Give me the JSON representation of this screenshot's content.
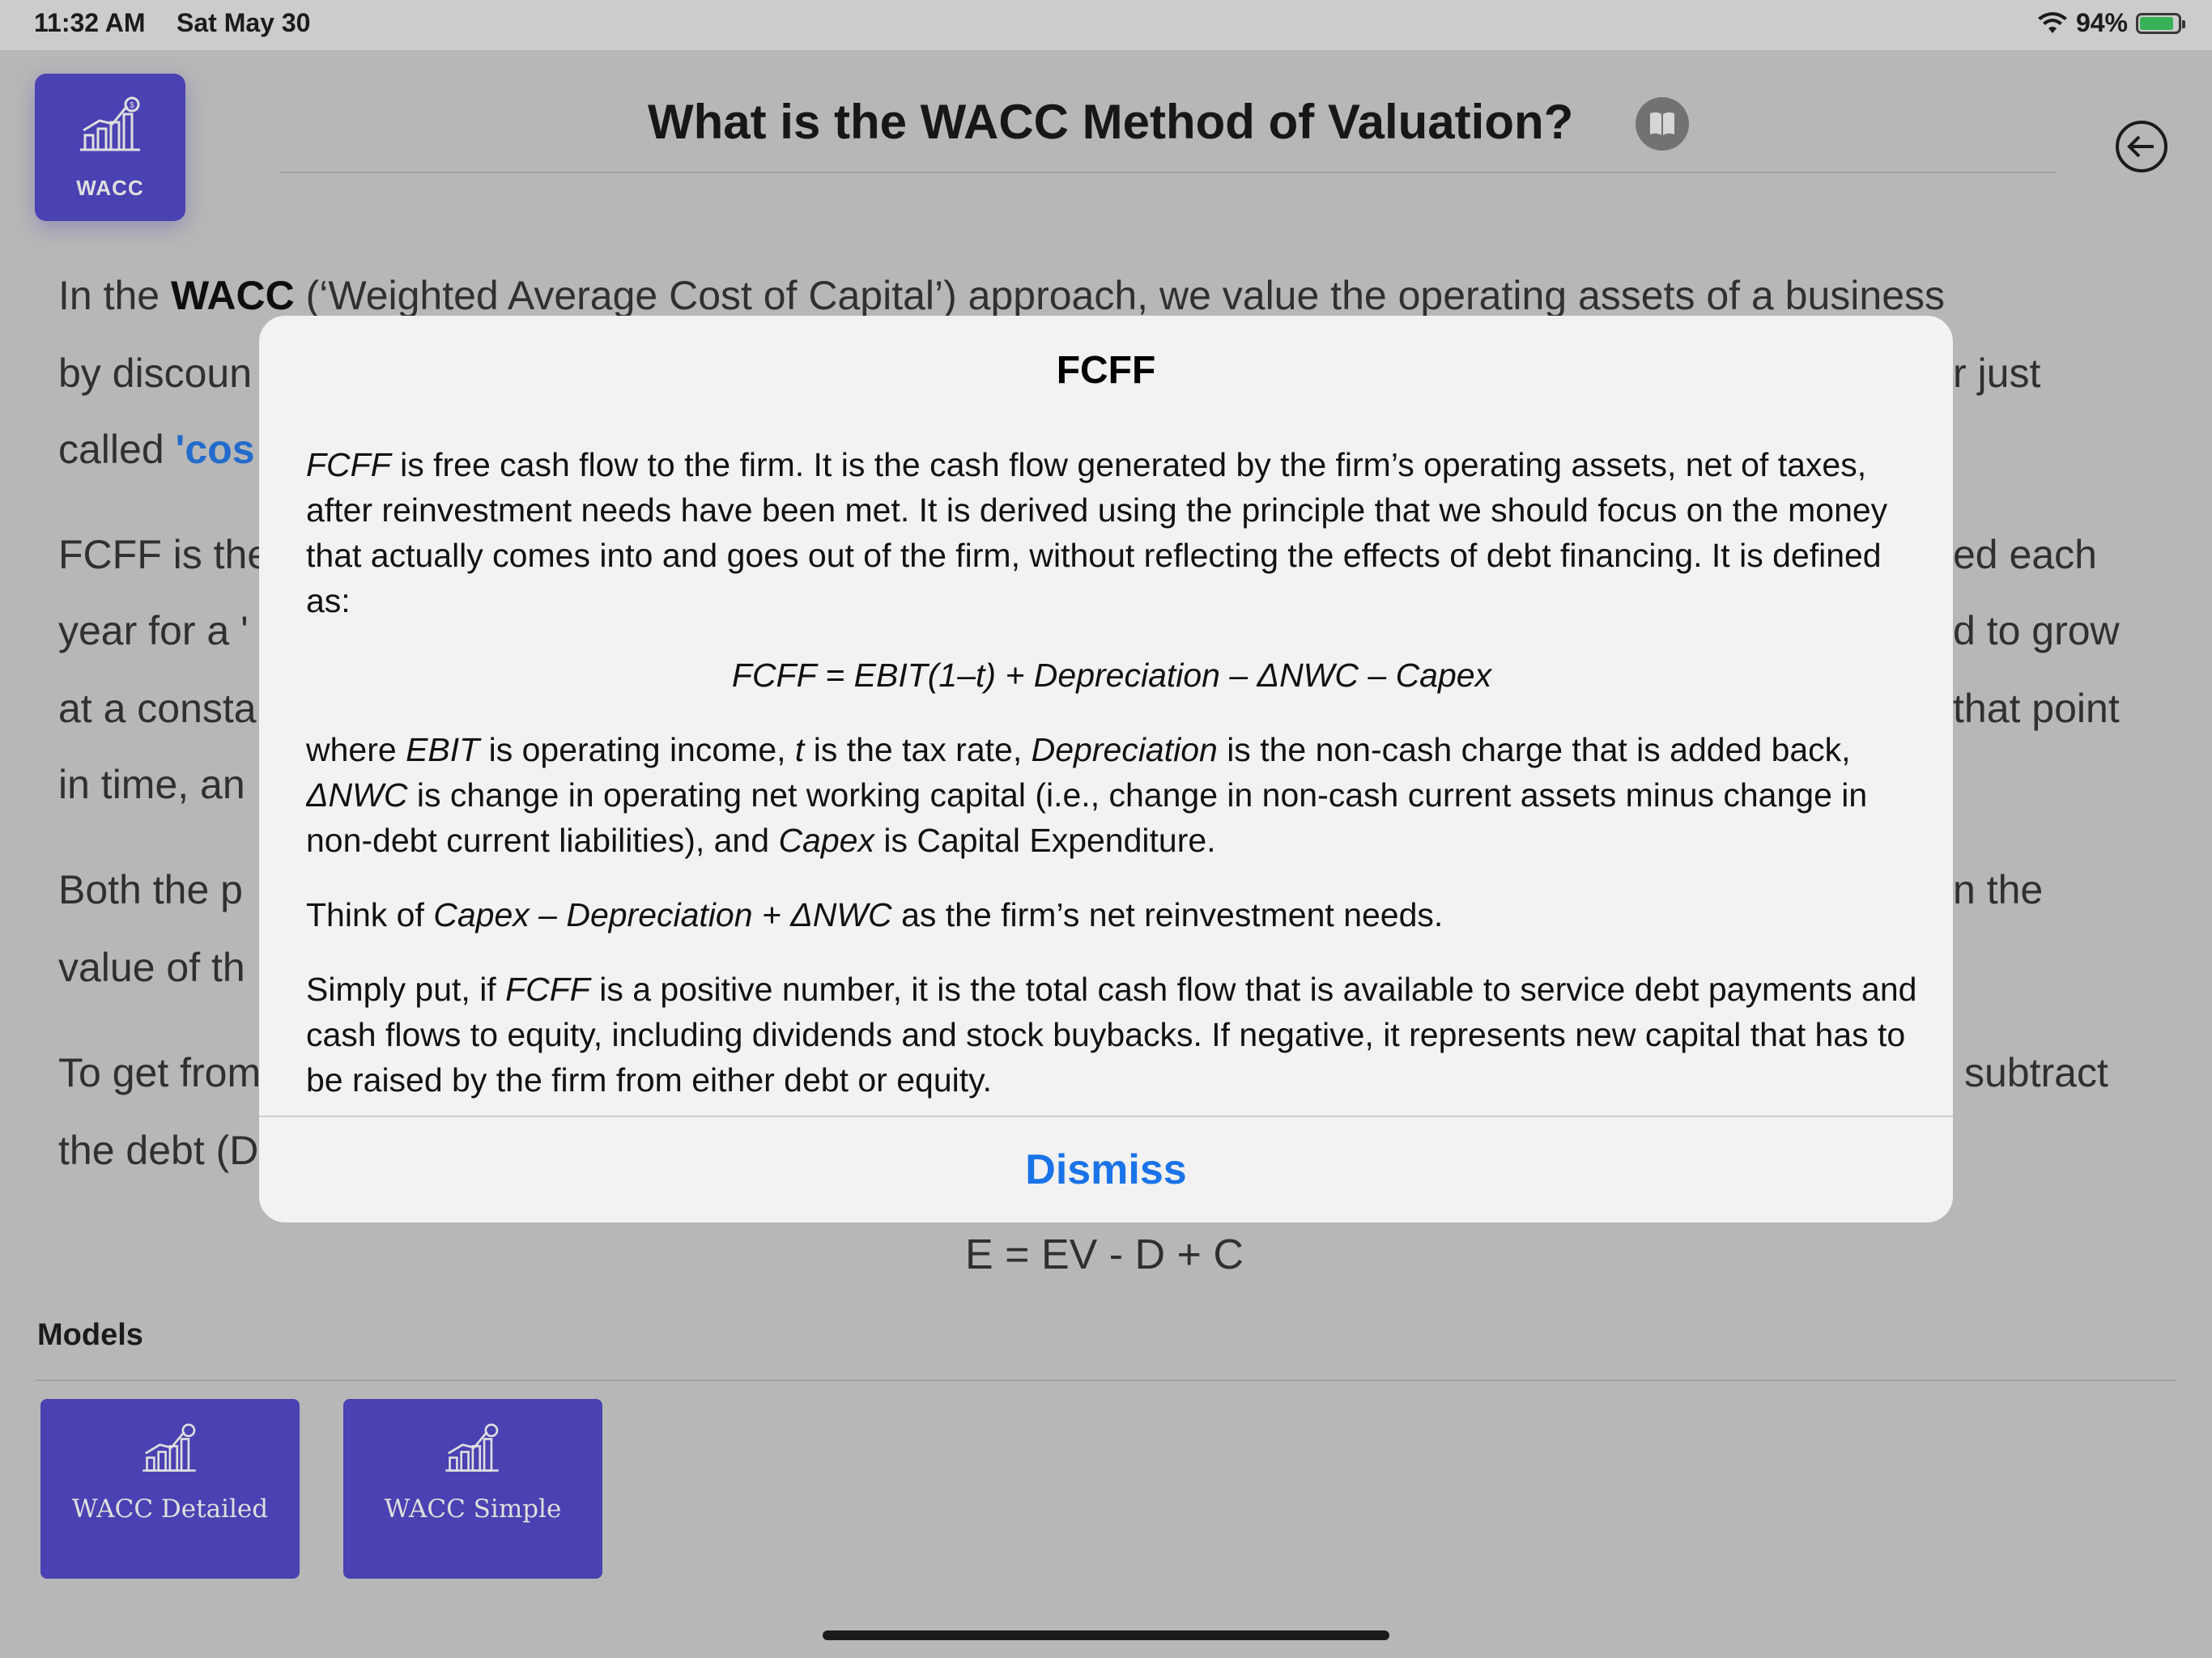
{
  "status_bar": {
    "time": "11:32 AM",
    "date": "Sat May 30",
    "battery_text": "94%",
    "battery_level": 0.94,
    "battery_color": "#35c759"
  },
  "app": {
    "badge_label": "WACC",
    "badge_icon": "bar-chart-dollar-icon",
    "accent_color": "#4a3fc9",
    "title": "What is the WACC Method of Valuation?",
    "title_icon": "book-icon",
    "back_icon": "back-arrow-icon"
  },
  "article": {
    "lines": [
      {
        "pre": "In the ",
        "bold": "WACC",
        "post": " (‘Weighted Average Cost of Capital’) approach, we value the operating assets of a business"
      },
      {
        "text": "by discoun"
      },
      {
        "pre": "called ",
        "blue": "'cos"
      },
      {
        "text": "FCFF is the"
      },
      {
        "text": "year for a '"
      },
      {
        "text": "at a consta"
      },
      {
        "text": "in time, an"
      },
      {
        "text": "Both the p"
      },
      {
        "text": "value of th"
      },
      {
        "text": "To get from"
      },
      {
        "text": "the debt (D"
      }
    ],
    "right_fragments": [
      {
        "text": "r just"
      },
      {
        "text": "ed each"
      },
      {
        "text": "d to grow"
      },
      {
        "text": "that point"
      },
      {
        "text": "n the"
      },
      {
        "text": "subtract"
      }
    ],
    "formula": "E = EV - D + C"
  },
  "models": {
    "heading": "Models",
    "items": [
      {
        "label": "WACC Detailed",
        "icon": "bar-chart-dollar-icon"
      },
      {
        "label": "WACC Simple",
        "icon": "bar-chart-dollar-icon"
      }
    ]
  },
  "modal": {
    "title": "FCFF",
    "p1_term": "FCFF",
    "p1_rest": " is free cash flow to the firm. It is the cash flow generated by the firm’s operating assets, net of taxes, after reinvestment needs have been met. It is derived using the principle that we should focus on the money that actually comes into and goes out of the firm, without reflecting the effects of debt financing. It is defined as:",
    "equation": "FCFF = EBIT(1–t) + Depreciation – ΔNWC – Capex",
    "p2": {
      "a": "where ",
      "b": "EBIT",
      "c": " is operating income, ",
      "d": "t",
      "e": " is the tax rate, ",
      "f": "Depreciation",
      "g": " is the non-cash charge that is added back, ",
      "h": "ΔNWC",
      "i": " is change in operating net working capital (i.e., change in non-cash current assets minus change in non-debt current liabilities), and ",
      "j": "Capex",
      "k": " is Capital Expenditure."
    },
    "p3": {
      "a": "Think of ",
      "b": "Capex – Depreciation + ΔNWC",
      "c": " as the firm’s net reinvestment needs."
    },
    "p4": {
      "a": "Simply put, if ",
      "b": "FCFF",
      "c": " is a positive number, it is the total cash flow that is available to service debt payments and cash flows to equity, including dividends and stock buybacks. If negative, it represents new capital that has to be raised by the firm from either debt or equity."
    },
    "dismiss_label": "Dismiss",
    "link_color": "#1a73e8"
  }
}
